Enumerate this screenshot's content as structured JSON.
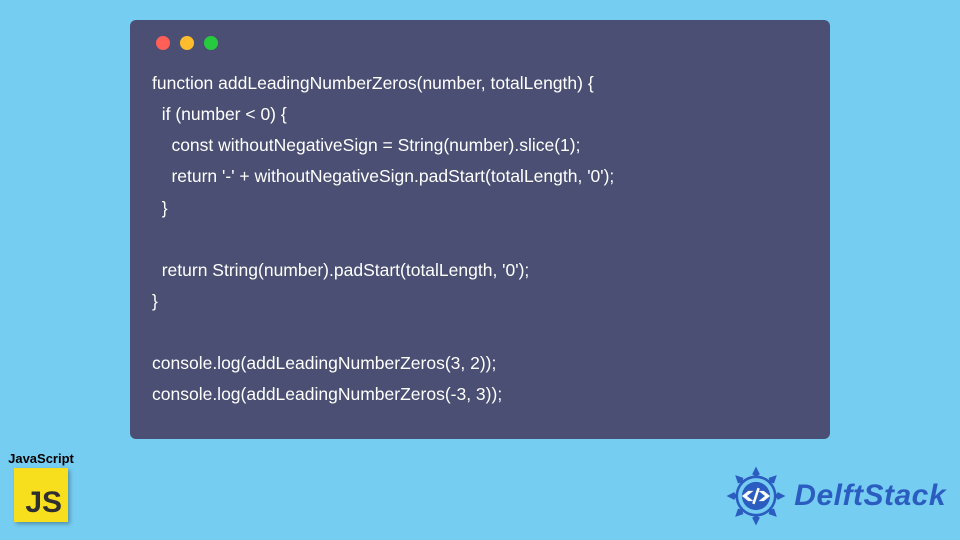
{
  "window": {
    "traffic_colors": {
      "red": "#ff5f56",
      "yellow": "#ffbd2e",
      "green": "#27c93f"
    },
    "bg": "#4a4f73"
  },
  "code": {
    "line1": "function addLeadingNumberZeros(number, totalLength) {",
    "line2": "  if (number < 0) {",
    "line3": "    const withoutNegativeSign = String(number).slice(1);",
    "line4": "    return '-' + withoutNegativeSign.padStart(totalLength, '0');",
    "line5": "  }",
    "line6": "",
    "line7": "  return String(number).padStart(totalLength, '0');",
    "line8": "}",
    "line9": "",
    "line10": "console.log(addLeadingNumberZeros(3, 2));",
    "line11": "console.log(addLeadingNumberZeros(-3, 3));"
  },
  "badges": {
    "js_label": "JavaScript",
    "js_letters": {
      "j": "J",
      "s": "S"
    },
    "delft_text": "DelftStack"
  }
}
